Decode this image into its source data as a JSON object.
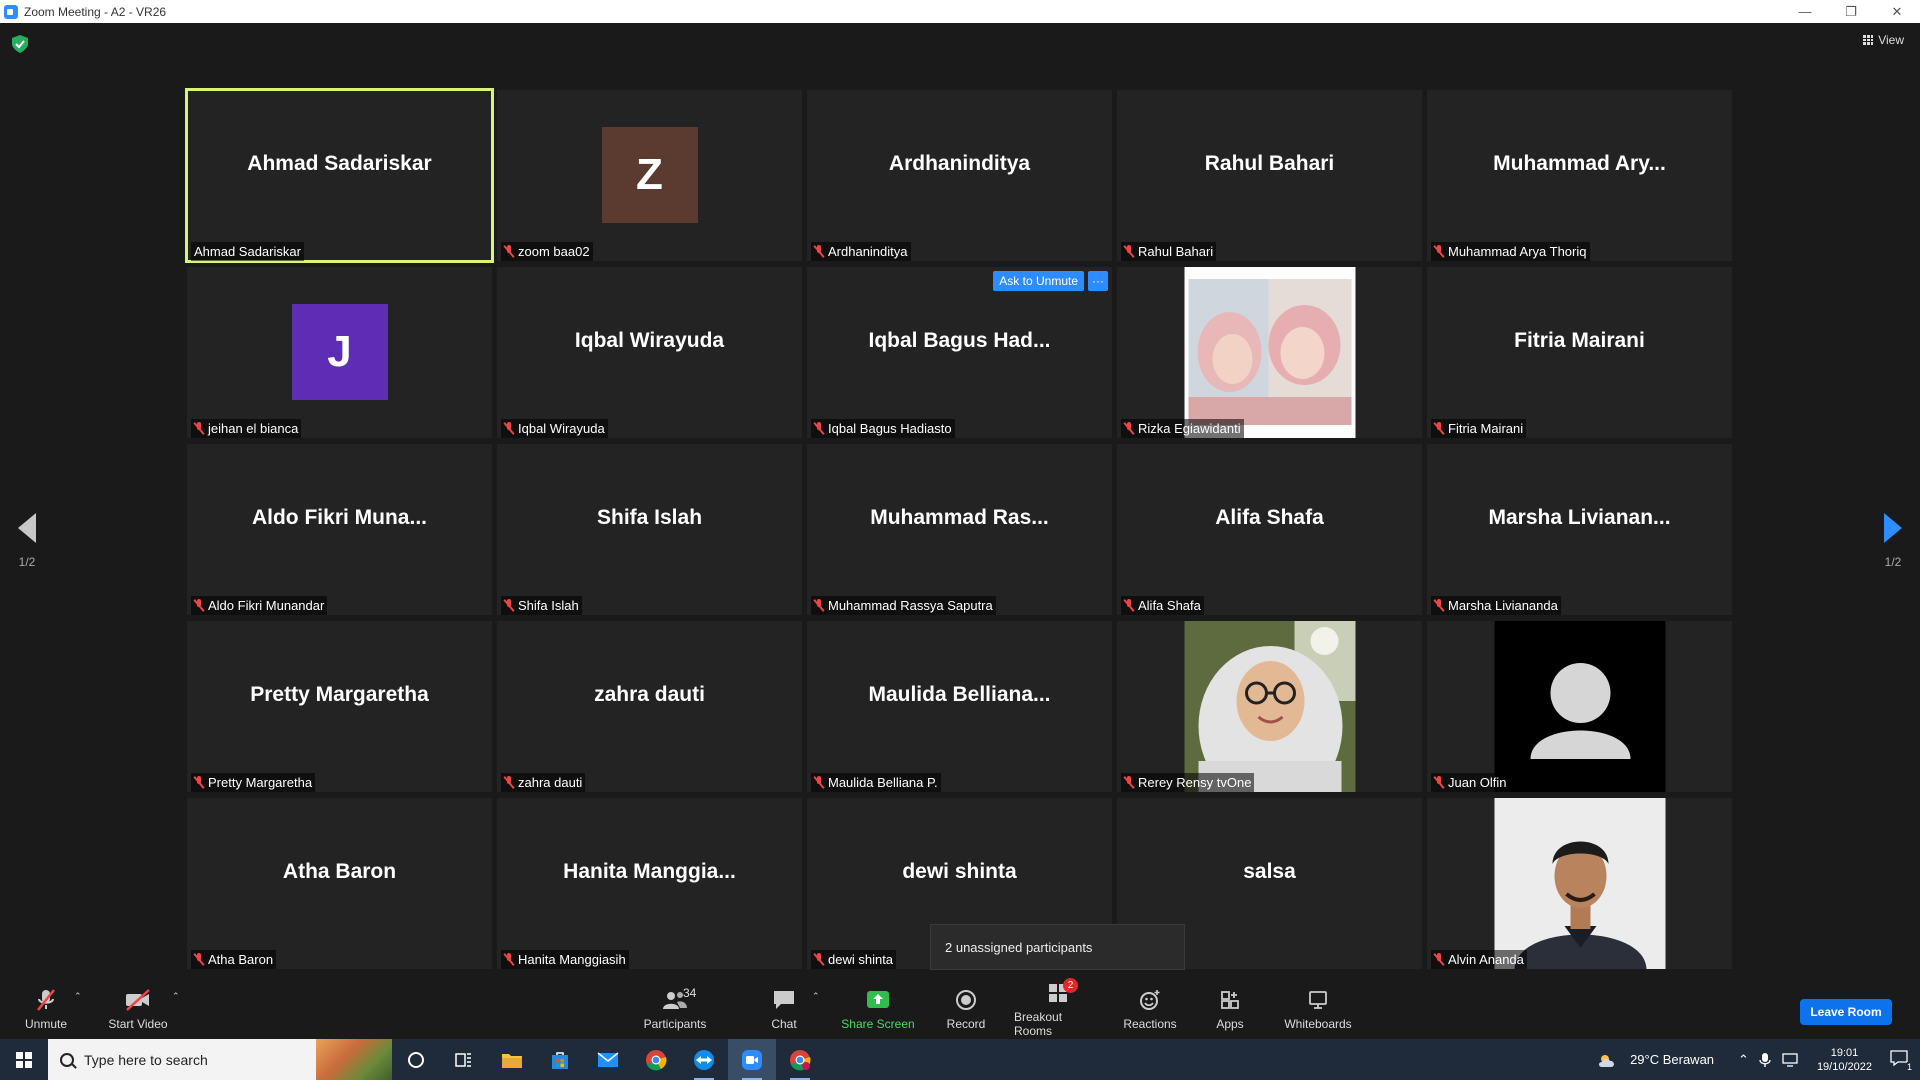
{
  "window": {
    "title": "Zoom Meeting - A2 - VR26",
    "minimize": "—",
    "restore": "❐",
    "close": "✕"
  },
  "meeting": {
    "view_label": "View",
    "page_indicator_left": "1/2",
    "page_indicator_right": "1/2",
    "ask_to_unmute_label": "Ask to Unmute",
    "more_label": "···",
    "unassigned_popup": "2 unassigned participants"
  },
  "tiles": [
    {
      "big": "Ahmad Sadariskar",
      "label": "Ahmad Sadariskar",
      "muted": false,
      "active": true
    },
    {
      "big": "",
      "label": "zoom baa02",
      "muted": true,
      "avatar_letter": "Z",
      "avatar_color": "#5b3a30"
    },
    {
      "big": "Ardhaninditya",
      "label": "Ardhaninditya",
      "muted": true
    },
    {
      "big": "Rahul Bahari",
      "label": "Rahul Bahari",
      "muted": true
    },
    {
      "big": "Muhammad  Ary...",
      "label": "Muhammad Arya Thoriq",
      "muted": true
    },
    {
      "big": "",
      "label": "jeihan el bianca",
      "muted": true,
      "avatar_letter": "J",
      "avatar_color": "#5d2db5"
    },
    {
      "big": "Iqbal Wirayuda",
      "label": "Iqbal Wirayuda",
      "muted": true
    },
    {
      "big": "Iqbal Bagus Had...",
      "label": "Iqbal Bagus Hadiasto",
      "muted": true,
      "hover_controls": true
    },
    {
      "big": "",
      "label": "Rizka Egiawidanti",
      "muted": true,
      "video": "photo-pink"
    },
    {
      "big": "Fitria Mairani",
      "label": "Fitria Mairani",
      "muted": true
    },
    {
      "big": "Aldo  Fikri  Muna...",
      "label": "Aldo Fikri Munandar",
      "muted": true
    },
    {
      "big": "Shifa Islah",
      "label": "Shifa Islah",
      "muted": true
    },
    {
      "big": "Muhammad  Ras...",
      "label": "Muhammad Rassya Saputra",
      "muted": true
    },
    {
      "big": "Alifa Shafa",
      "label": "Alifa Shafa",
      "muted": true
    },
    {
      "big": "Marsha  Livianan...",
      "label": "Marsha Liviananda",
      "muted": true
    },
    {
      "big": "Pretty Margaretha",
      "label": "Pretty Margaretha",
      "muted": true
    },
    {
      "big": "zahra dauti",
      "label": "zahra dauti",
      "muted": true
    },
    {
      "big": "Maulida  Belliana...",
      "label": "Maulida Belliana P.",
      "muted": true
    },
    {
      "big": "",
      "label": "Rerey Rensy tvOne",
      "muted": true,
      "video": "photo-hijab"
    },
    {
      "big": "",
      "label": "Juan Olfin",
      "muted": true,
      "video": "placeholder-person"
    },
    {
      "big": "Atha Baron",
      "label": "Atha Baron",
      "muted": true
    },
    {
      "big": "Hanita  Manggia...",
      "label": "Hanita Manggiasih",
      "muted": true
    },
    {
      "big": "dewi shinta",
      "label": "dewi shinta",
      "muted": true
    },
    {
      "big": "salsa",
      "label": "",
      "muted": false
    },
    {
      "big": "",
      "label": "Alvin Ananda",
      "muted": true,
      "video": "photo-man"
    }
  ],
  "toolbar": {
    "unmute_label": "Unmute",
    "start_video_label": "Start Video",
    "participants_label": "Participants",
    "participants_count": "34",
    "chat_label": "Chat",
    "share_screen_label": "Share Screen",
    "record_label": "Record",
    "breakout_rooms_label": "Breakout Rooms",
    "breakout_badge": "2",
    "reactions_label": "Reactions",
    "apps_label": "Apps",
    "whiteboards_label": "Whiteboards",
    "leave_label": "Leave Room"
  },
  "taskbar": {
    "search_placeholder": "Type here to search",
    "weather": "29°C  Berawan",
    "time": "19:01",
    "date": "19/10/2022",
    "notification_count": "1"
  },
  "colors": {
    "accent_blue": "#2d8cff",
    "active_speaker": "#d8f57a",
    "share_green": "#4cd964",
    "mute_red": "#e44444"
  }
}
